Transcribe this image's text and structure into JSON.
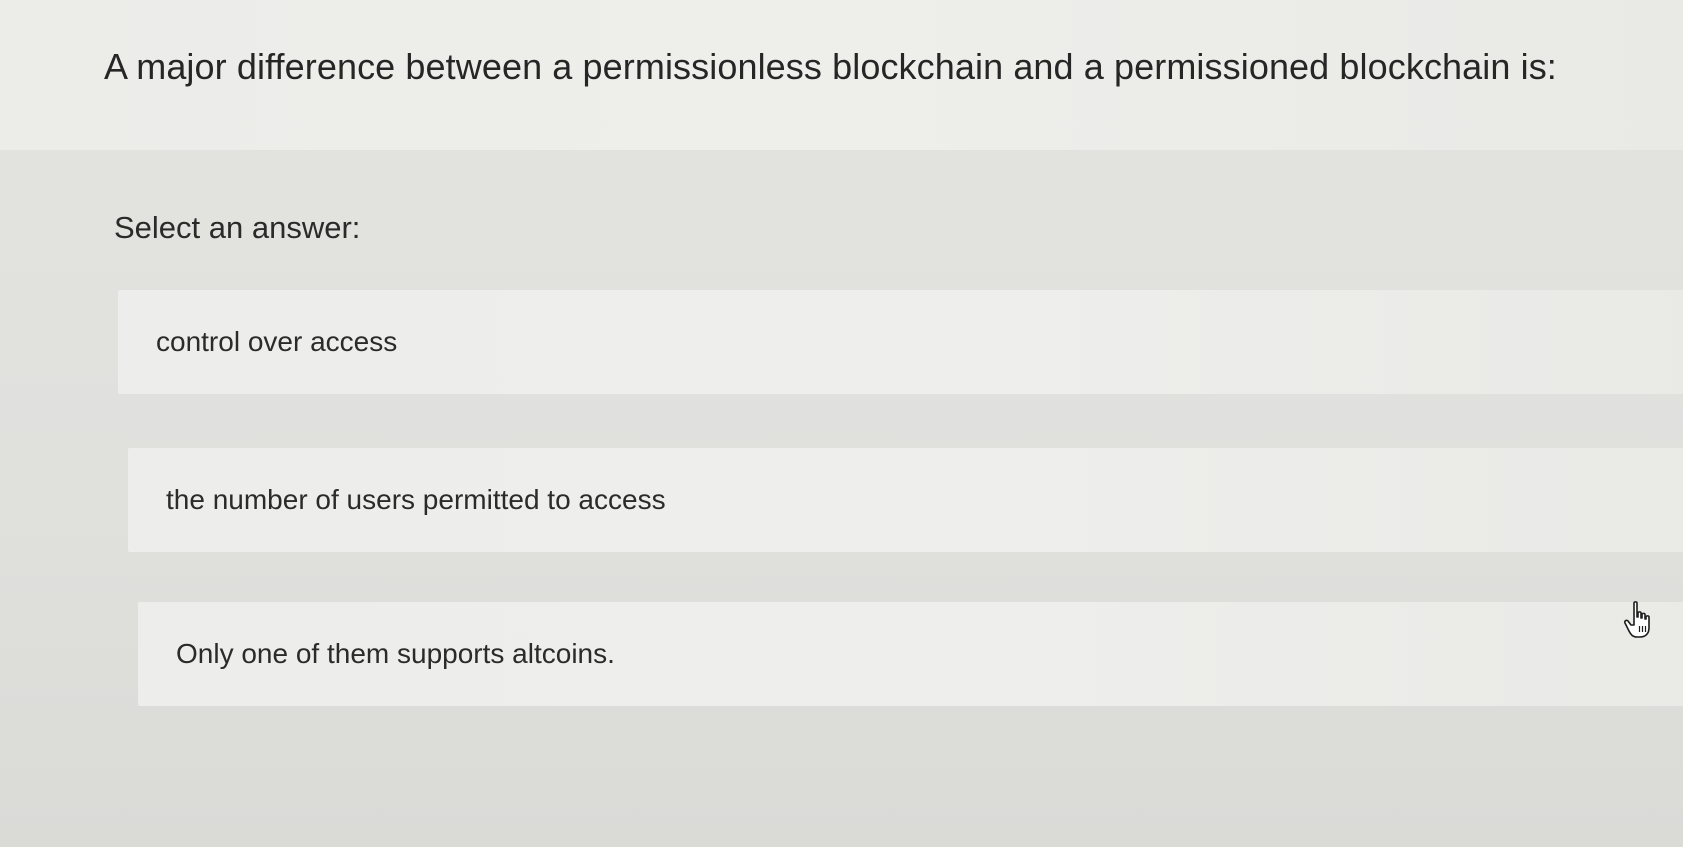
{
  "question": {
    "text": "A major difference between a permissionless blockchain and a permissioned blockchain is:"
  },
  "prompt": {
    "text": "Select an answer:"
  },
  "options": [
    {
      "label": "control over access"
    },
    {
      "label": "the number of users permitted to access"
    },
    {
      "label": "Only one of them supports altcoins."
    }
  ],
  "icons": {
    "cursor": "hand-pointer-icon"
  }
}
